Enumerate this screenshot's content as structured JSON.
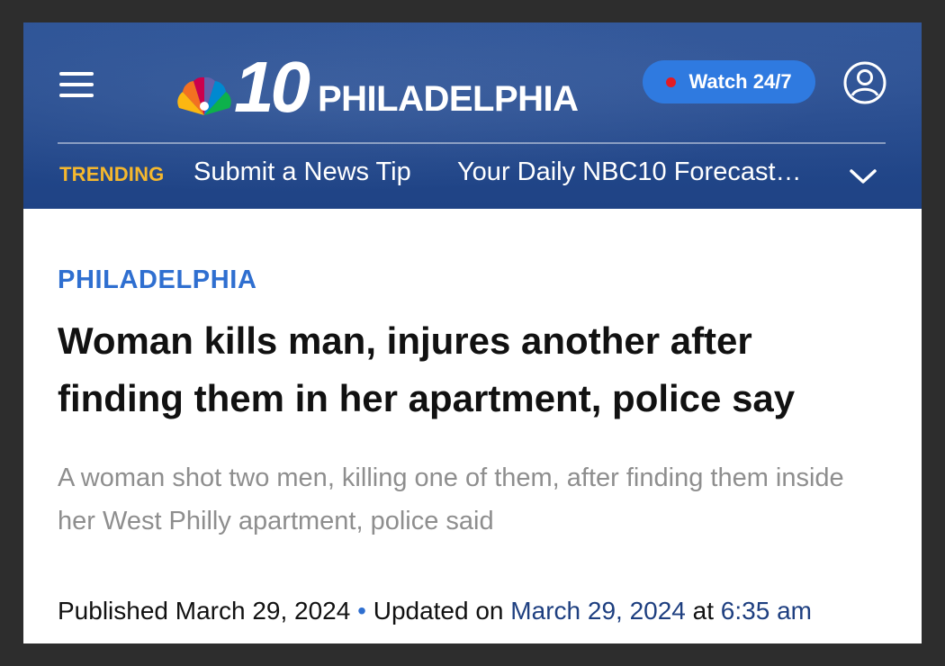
{
  "header": {
    "brand_number": "10",
    "brand_city": "PHILADELPHIA",
    "watch_label": "Watch 24/7",
    "colors": {
      "header_bg": "#24498c",
      "accent": "#2f7ae0",
      "live": "#e31b23",
      "trending": "#f5b82e"
    }
  },
  "trending": {
    "label": "TRENDING",
    "links": [
      "Submit a News Tip",
      "Your Daily NBC10 Forecast…"
    ]
  },
  "article": {
    "section": "PHILADELPHIA",
    "headline": "Woman kills man, injures another after finding them in her apartment, police say",
    "deck": "A woman shot two men, killing one of them, after finding them inside her West Philly apartment, police said",
    "published_label": "Published",
    "published_date": "March 29, 2024",
    "bullet": "•",
    "updated_label": "Updated on",
    "updated_date": "March 29, 2024",
    "at_label": "at",
    "updated_time": "6:35 am"
  },
  "icons": [
    "menu-icon",
    "nbc-peacock-logo",
    "live-dot-icon",
    "user-account-icon",
    "chevron-down-icon"
  ]
}
